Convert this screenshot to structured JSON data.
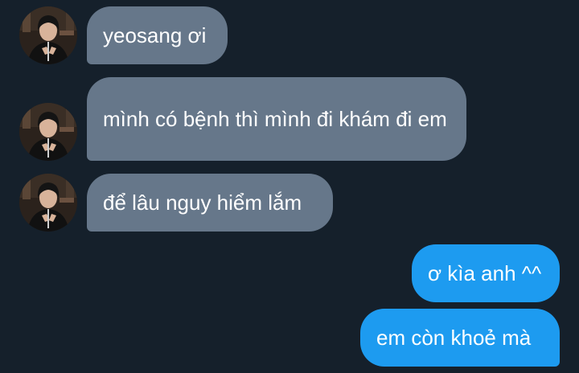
{
  "conversation": {
    "messages": [
      {
        "direction": "incoming",
        "text": "yeosang ơi",
        "avatar": "user-avatar"
      },
      {
        "direction": "incoming",
        "text": "mình có bệnh thì mình đi khám đi em",
        "avatar": "user-avatar"
      },
      {
        "direction": "incoming",
        "text": "để lâu nguy hiểm lắm",
        "avatar": "user-avatar"
      },
      {
        "direction": "outgoing",
        "text": "ơ kìa anh ^^"
      },
      {
        "direction": "outgoing",
        "text": "em còn khoẻ mà"
      }
    ]
  },
  "colors": {
    "background": "#15202b",
    "incoming_bubble": "#66778a",
    "outgoing_bubble": "#1d9bf0",
    "text": "#ffffff"
  }
}
